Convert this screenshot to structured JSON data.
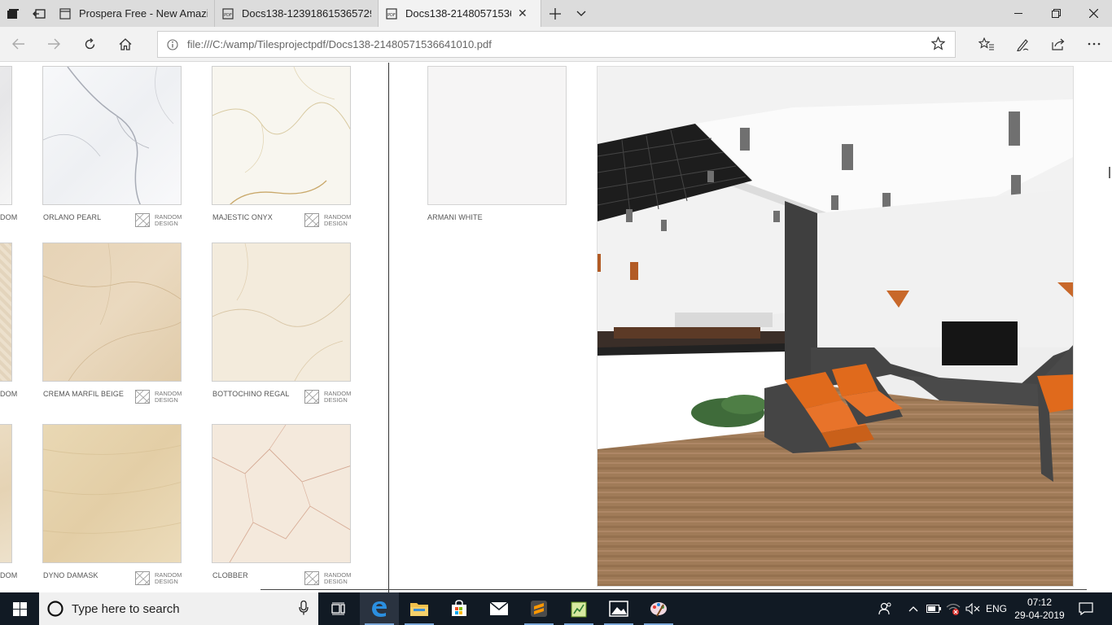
{
  "browser": {
    "tabs": [
      {
        "title": "Prospera Free - New Amazi",
        "icon": "page-icon",
        "active": false
      },
      {
        "title": "Docs138-123918615365729",
        "icon": "pdf-icon",
        "active": false
      },
      {
        "title": "Docs138-21480571536",
        "icon": "pdf-icon",
        "active": true
      }
    ],
    "url": "file:///C:/wamp/Tilesprojectpdf/Docs138-21480571536641010.pdf"
  },
  "catalog": {
    "left_page": {
      "cut_labels": [
        "DOM",
        "DOM",
        "DOM"
      ],
      "tiles": [
        {
          "name": "ORLANO PEARL",
          "design": [
            "RANDOM",
            "DESIGN"
          ]
        },
        {
          "name": "MAJESTIC ONYX",
          "design": [
            "RANDOM",
            "DESIGN"
          ]
        },
        {
          "name": "CREMA MARFIL BEIGE",
          "design": [
            "RANDOM",
            "DESIGN"
          ]
        },
        {
          "name": "BOTTOCHINO REGAL",
          "design": [
            "RANDOM",
            "DESIGN"
          ]
        },
        {
          "name": "DYNO DAMASK",
          "design": [
            "RANDOM",
            "DESIGN"
          ]
        },
        {
          "name": "CLOBBER",
          "design": [
            "RANDOM",
            "DESIGN"
          ]
        }
      ]
    },
    "right_page": {
      "tile": {
        "name": "ARMANI WHITE"
      }
    }
  },
  "taskbar": {
    "search_placeholder": "Type here to search",
    "language": "ENG",
    "time": "07:12",
    "date": "29-04-2019"
  }
}
